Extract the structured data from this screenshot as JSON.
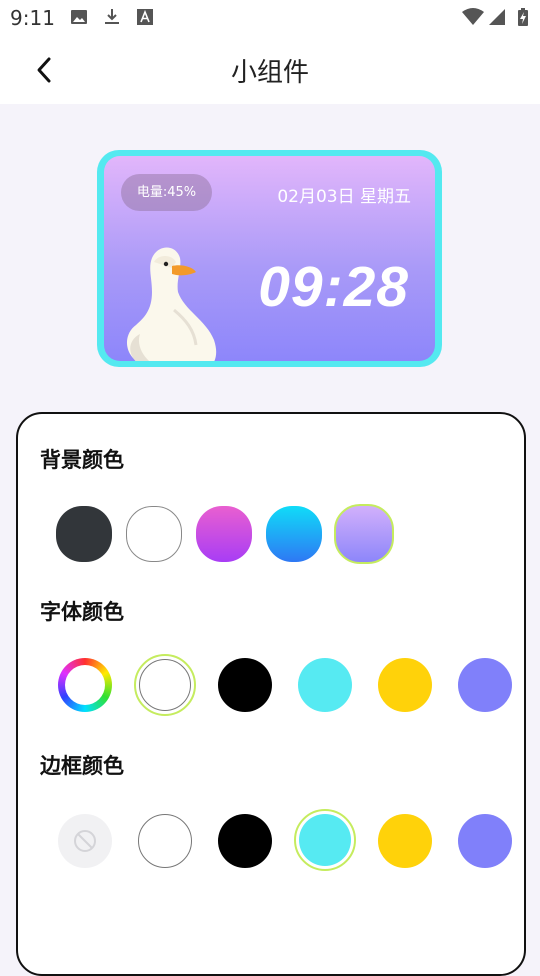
{
  "status_bar": {
    "time": "9:11",
    "icons": [
      "image-icon",
      "download-icon",
      "font-icon",
      "wifi-icon",
      "signal-icon",
      "battery-charging-icon"
    ]
  },
  "app_bar": {
    "title": "小组件",
    "back_icon": "chevron-left-icon"
  },
  "widget_preview": {
    "battery_text": "电量:45%",
    "date_text": "02月03日 星期五",
    "time_text": "09:28",
    "border_color": "#54e9f0",
    "gradient_top": "#e2b6fb",
    "gradient_bottom": "#8d86fa"
  },
  "settings": {
    "background_color": {
      "title": "背景颜色",
      "options": [
        {
          "name": "dark-gray",
          "color": "#32363a"
        },
        {
          "name": "white",
          "color": "#ffffff"
        },
        {
          "name": "pink-purple-gradient",
          "color": "#c44bf0"
        },
        {
          "name": "cyan-blue-gradient",
          "color": "#1ea2f8"
        },
        {
          "name": "lavender-gradient",
          "color": "#b79ff9",
          "selected": true
        }
      ]
    },
    "font_color": {
      "title": "字体颜色",
      "options": [
        {
          "name": "color-wheel",
          "color": "custom"
        },
        {
          "name": "white",
          "color": "#ffffff",
          "selected": true
        },
        {
          "name": "black",
          "color": "#000000"
        },
        {
          "name": "cyan",
          "color": "#56eaf2"
        },
        {
          "name": "yellow",
          "color": "#ffd20a"
        },
        {
          "name": "periwinkle",
          "color": "#8080fa"
        }
      ]
    },
    "border_color": {
      "title": "边框颜色",
      "options": [
        {
          "name": "none",
          "color": "none"
        },
        {
          "name": "white",
          "color": "#ffffff"
        },
        {
          "name": "black",
          "color": "#000000"
        },
        {
          "name": "cyan",
          "color": "#56eaf2",
          "selected": true
        },
        {
          "name": "yellow",
          "color": "#ffd20a"
        },
        {
          "name": "periwinkle",
          "color": "#8080fa"
        }
      ]
    },
    "selected_ring_color": "#c5ec5e"
  }
}
